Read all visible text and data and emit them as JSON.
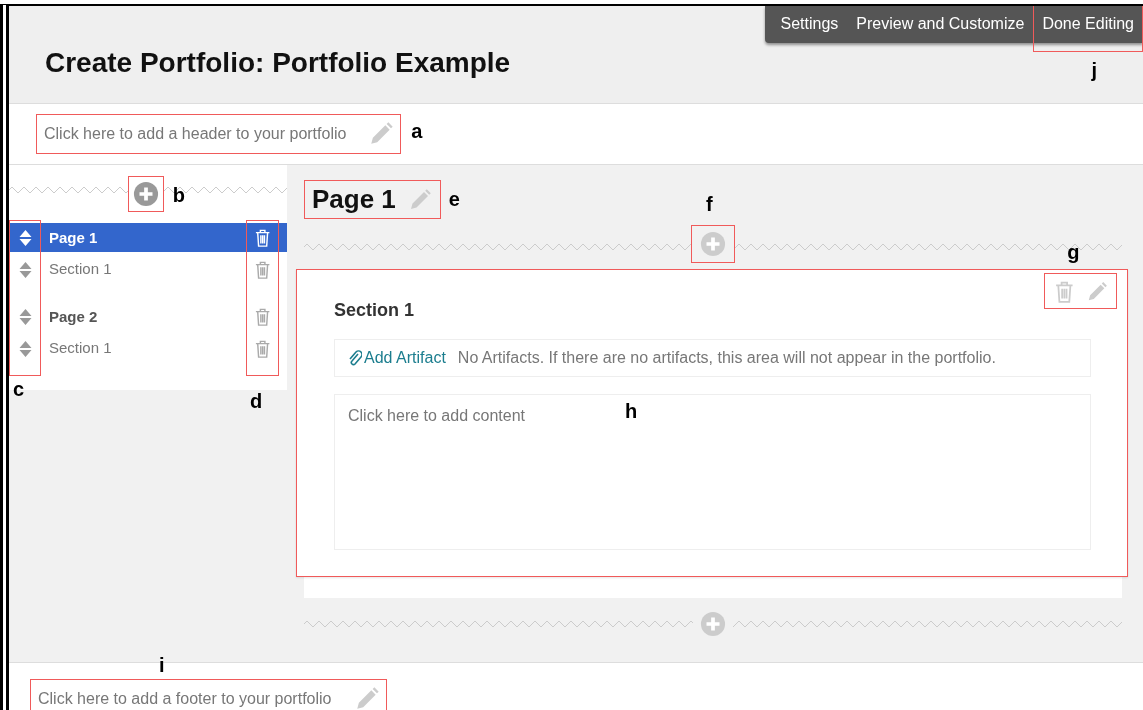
{
  "title": "Create Portfolio: Portfolio Example",
  "toolbar": [
    {
      "label": "Settings",
      "framed": false
    },
    {
      "label": "Preview and Customize",
      "framed": false
    },
    {
      "label": "Done Editing",
      "framed": true,
      "callout": "j"
    }
  ],
  "header": {
    "prompt": "Click here to add a header to your portfolio",
    "callout": "a"
  },
  "sidebar": {
    "add_callout": "b",
    "handles_callout": "c",
    "delete_callout": "d",
    "items": [
      {
        "kind": "page",
        "label": "Page 1",
        "selected": true
      },
      {
        "kind": "section",
        "label": "Section 1",
        "selected": false
      },
      {
        "kind": "page",
        "label": "Page 2",
        "selected": false
      },
      {
        "kind": "section",
        "label": "Section 1",
        "selected": false
      }
    ]
  },
  "page": {
    "title": "Page 1",
    "title_callout": "e",
    "add_callout": "f",
    "section": {
      "title": "Section 1",
      "tools_callout": "g",
      "add_artifact": "Add Artifact",
      "artifact_note": "No Artifacts. If there are no artifacts, this area will not appear in the portfolio.",
      "content_prompt": "Click here to add content",
      "content_callout": "h"
    }
  },
  "footer": {
    "prompt": "Click here to add a footer to your portfolio",
    "callout": "i"
  }
}
